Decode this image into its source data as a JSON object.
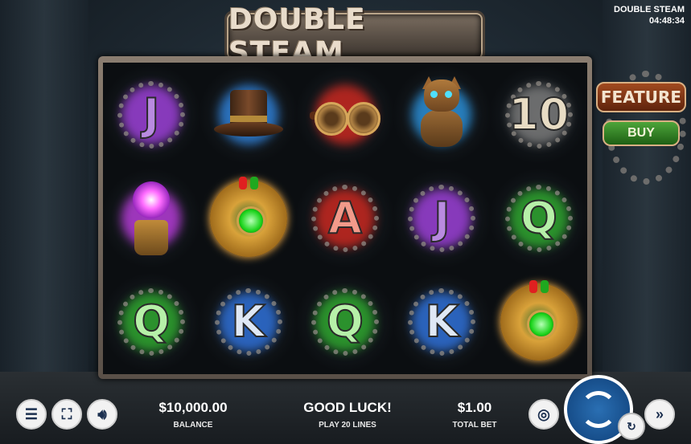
{
  "game": {
    "title": "DOUBLE STEAM",
    "clock": "04:48:34",
    "logo_text": "DOUBLE STEAM"
  },
  "reels": [
    [
      {
        "symbol": "J",
        "glow": "#9b3fd6",
        "color": "#b98be0"
      },
      {
        "symbol": "lamp",
        "glow": "#b53bd6"
      },
      {
        "symbol": "Q",
        "glow": "#2ea52e",
        "color": "#b6f0a8"
      }
    ],
    [
      {
        "symbol": "tophat",
        "glow": "#2e7fd6"
      },
      {
        "symbol": "wild",
        "glow": "#d9a23a"
      },
      {
        "symbol": "K",
        "glow": "#2e6fd6",
        "color": "#dfe8f5"
      }
    ],
    [
      {
        "symbol": "goggles",
        "glow": "#c8271f"
      },
      {
        "symbol": "A",
        "glow": "#c8271f",
        "color": "#f29a8a"
      },
      {
        "symbol": "Q",
        "glow": "#2ea52e",
        "color": "#b6f0a8"
      }
    ],
    [
      {
        "symbol": "cat",
        "glow": "#2a8ed6"
      },
      {
        "symbol": "J",
        "glow": "#9b3fd6",
        "color": "#b98be0"
      },
      {
        "symbol": "K",
        "glow": "#2e6fd6",
        "color": "#dfe8f5"
      }
    ],
    [
      {
        "symbol": "10",
        "glow": "#7a7a7a",
        "color": "#e8dcc4"
      },
      {
        "symbol": "Q",
        "glow": "#2ea52e",
        "color": "#b6f0a8"
      },
      {
        "symbol": "wild",
        "glow": "#d9a23a"
      }
    ]
  ],
  "side_panel": {
    "feature_label": "FEATURE",
    "buy_label": "BUY"
  },
  "footer": {
    "balance_value": "$10,000.00",
    "balance_label": "BALANCE",
    "message": "GOOD LUCK!",
    "lines_label": "PLAY 20 LINES",
    "bet_value": "$1.00",
    "bet_label": "TOTAL BET"
  },
  "icons": {
    "menu": "menu-icon",
    "fullscreen": "fullscreen-icon",
    "sound": "speaker-icon",
    "coins": "coins-icon",
    "spin": "spin-arrows-icon",
    "autoplay": "autoplay-icon",
    "turbo": "fast-forward-icon"
  }
}
